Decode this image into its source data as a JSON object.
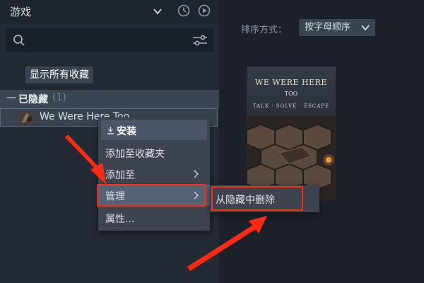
{
  "sidebar": {
    "title": "游戏",
    "icons": [
      "chevron-down-icon",
      "clock-icon",
      "play-icon"
    ],
    "search": {
      "placeholder": ""
    },
    "show_all_label": "显示所有收藏",
    "hidden_section": {
      "label": "已隐藏",
      "count": "(1)"
    },
    "game": {
      "name": "We Were Here Too"
    }
  },
  "main": {
    "sort_label": "排序方式：",
    "sort_value": "按字母顺序"
  },
  "cover": {
    "title": "WE WERE HERE",
    "subtitle": "TOO",
    "tagline": "TALK · SOLVE · ESCAPE"
  },
  "context_menu": {
    "items": [
      {
        "label": "安装"
      },
      {
        "label": "添加至收藏夹"
      },
      {
        "label": "添加至"
      },
      {
        "label": "管理"
      },
      {
        "label": "属性..."
      }
    ]
  },
  "submenu": {
    "items": [
      {
        "label": "从隐藏中删除"
      }
    ]
  },
  "colors": {
    "highlight": "#ff2a14",
    "menu_bg": "#3d4450",
    "sidebar_bg": "#232a33"
  }
}
